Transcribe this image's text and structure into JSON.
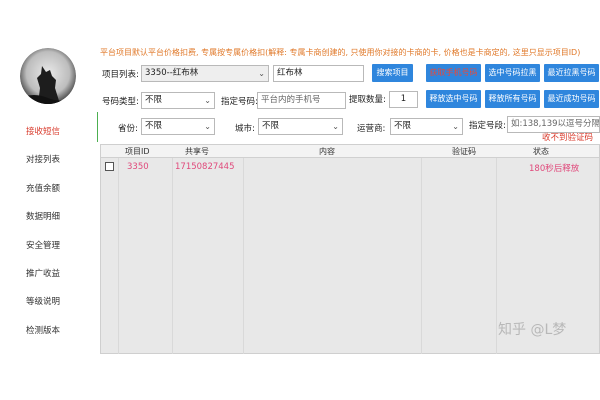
{
  "sidebar": {
    "items": [
      {
        "label": "接收短信",
        "active": true
      },
      {
        "label": "对接列表"
      },
      {
        "label": "充值余额"
      },
      {
        "label": "数据明细"
      },
      {
        "label": "安全管理"
      },
      {
        "label": "推广收益"
      },
      {
        "label": "等级说明"
      },
      {
        "label": "检测版本"
      }
    ]
  },
  "notice": "平台项目默认平台价格扣费, 专属按专属价格扣(解释: 专属卡商创建的, 只使用你对接的卡商的卡, 价格也是卡商定的, 这里只显示项目ID)",
  "row1": {
    "project_label": "项目列表:",
    "project_value": "3350--红布林",
    "search_value": "红布林",
    "search_button": "搜索项目",
    "btn_get_number": "获取手机号码",
    "btn_pull_selected": "选中号码拉黑",
    "btn_recent_blacklist": "最近拉黑号码"
  },
  "row2": {
    "number_type_label": "号码类型:",
    "number_type_value": "不限",
    "specify_number_label": "指定号码:",
    "specify_number_placeholder": "平台内的手机号",
    "fetch_count_label": "提取数量:",
    "fetch_count_value": "1",
    "btn_release_selected": "释放选中号码",
    "btn_release_all": "释放所有号码",
    "btn_recent_success": "最近成功号码"
  },
  "row3": {
    "province_label": "省份:",
    "province_value": "不限",
    "city_label": "城市:",
    "city_value": "不限",
    "carrier_label": "运营商:",
    "carrier_value": "不限",
    "segment_label": "指定号段:",
    "segment_placeholder": "如:138,139以逗号分隔",
    "status_text": "收不到验证码"
  },
  "table": {
    "headers": [
      "项目ID",
      "共享号",
      "内容",
      "验证码",
      "状态"
    ],
    "rows": [
      {
        "project_id": "3350",
        "shared_number": "17150827445",
        "content": "",
        "code": "",
        "status": "180秒后释放"
      }
    ]
  },
  "watermark": "知乎 @L梦",
  "colors": {
    "accent": "#2f86dd",
    "active_red": "#d93a2b",
    "notice_orange": "#e0792a",
    "row_pink": "#e0497b"
  }
}
